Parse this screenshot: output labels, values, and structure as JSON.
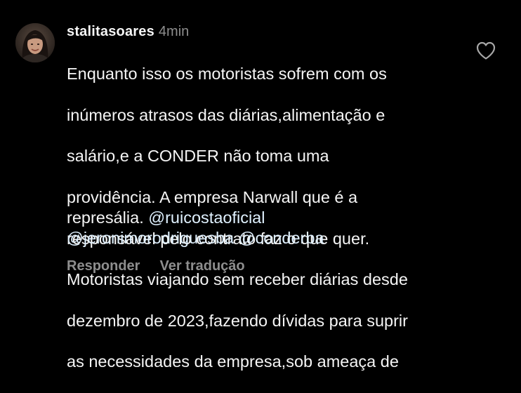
{
  "comment": {
    "username": "stalitasoares",
    "time": "4min",
    "body_lines": [
      "Enquanto isso os motoristas sofrem com os",
      "inúmeros atrasos das diárias,alimentação e",
      "salário,e a CONDER  não toma uma",
      "providência. A empresa Narwall que é a",
      "responsável pelo contrato faz o que quer.",
      "Motoristas viajando sem receber diárias desde",
      "dezembro de 2023,fazendo dívidas para suprir",
      "as necessidades da empresa,sob ameaça de"
    ],
    "last_line_prefix": "represália. ",
    "mention_1": "@ruicostaoficial",
    "mention_2": "@jeronimorodriguesba",
    "mention_3": "@conderba",
    "actions": {
      "reply": "Responder",
      "translate": "Ver tradução"
    },
    "icons": {
      "like": "heart-outline-icon",
      "avatar": "profile-avatar"
    },
    "colors": {
      "background": "#000000",
      "text": "#f5f5f5",
      "muted": "#8e8e8e",
      "mention": "#e0f1ff"
    }
  }
}
